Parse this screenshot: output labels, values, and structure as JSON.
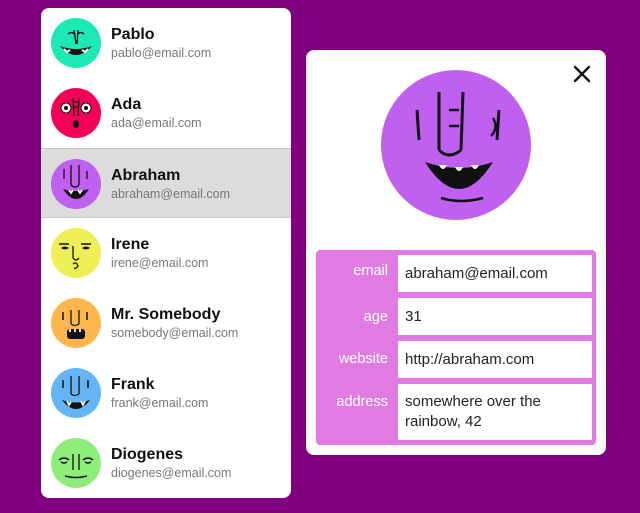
{
  "contacts": [
    {
      "name": "Pablo",
      "email": "pablo@email.com",
      "color": "#1de9b6",
      "icon": "pablo-avatar-icon"
    },
    {
      "name": "Ada",
      "email": "ada@email.com",
      "color": "#f50057",
      "icon": "ada-avatar-icon"
    },
    {
      "name": "Abraham",
      "email": "abraham@email.com",
      "color": "#c060f0",
      "icon": "abraham-avatar-icon"
    },
    {
      "name": "Irene",
      "email": "irene@email.com",
      "color": "#eeee55",
      "icon": "irene-avatar-icon"
    },
    {
      "name": "Mr. Somebody",
      "email": "somebody@email.com",
      "color": "#ffb74d",
      "icon": "somebody-avatar-icon"
    },
    {
      "name": "Frank",
      "email": "frank@email.com",
      "color": "#64b5f6",
      "icon": "frank-avatar-icon"
    },
    {
      "name": "Diogenes",
      "email": "diogenes@email.com",
      "color": "#8eee7a",
      "icon": "diogenes-avatar-icon"
    }
  ],
  "selected_index": 2,
  "detail": {
    "close_icon": "close-icon",
    "avatar_color": "#c060f0",
    "fields": [
      {
        "label": "email",
        "value": "abraham@email.com"
      },
      {
        "label": "age",
        "value": "31"
      },
      {
        "label": "website",
        "value": "http://abraham.com"
      },
      {
        "label": "address",
        "value": "somewhere over the rainbow, 42"
      }
    ]
  },
  "colors": {
    "background": "#800080",
    "accent": "#e07be4",
    "selected_row": "#dcdcdc"
  }
}
